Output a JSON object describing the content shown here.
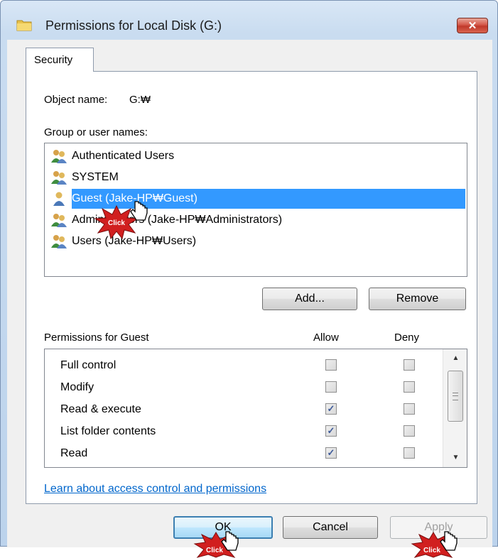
{
  "window": {
    "title": "Permissions for Local Disk (G:)",
    "close_symbol": "✕"
  },
  "tabs": [
    {
      "label": "Security"
    }
  ],
  "object": {
    "label": "Object name:",
    "value": "G:₩"
  },
  "group_label": "Group or user names:",
  "users": [
    {
      "name": "Authenticated Users",
      "icon": "group-users-icon"
    },
    {
      "name": "SYSTEM",
      "icon": "group-users-icon"
    },
    {
      "name": "Guest (Jake-HP₩Guest)",
      "icon": "user-icon",
      "selected": true
    },
    {
      "name": "Administrators (Jake-HP₩Administrators)",
      "icon": "group-users-icon"
    },
    {
      "name": "Users (Jake-HP₩Users)",
      "icon": "group-users-icon"
    }
  ],
  "buttons": {
    "add": "Add...",
    "remove": "Remove",
    "ok": "OK",
    "cancel": "Cancel",
    "apply": "Apply"
  },
  "permissions_header": {
    "title": "Permissions for Guest",
    "allow": "Allow",
    "deny": "Deny"
  },
  "permissions": [
    {
      "name": "Full control",
      "allow": false,
      "deny": false
    },
    {
      "name": "Modify",
      "allow": false,
      "deny": false
    },
    {
      "name": "Read & execute",
      "allow": true,
      "deny": false
    },
    {
      "name": "List folder contents",
      "allow": true,
      "deny": false
    },
    {
      "name": "Read",
      "allow": true,
      "deny": false
    }
  ],
  "link": "Learn about access control and permissions",
  "click_markers": {
    "label": "Click"
  },
  "colors": {
    "selection": "#3399ff",
    "link": "#0066cc",
    "marker": "#d11f1f"
  }
}
